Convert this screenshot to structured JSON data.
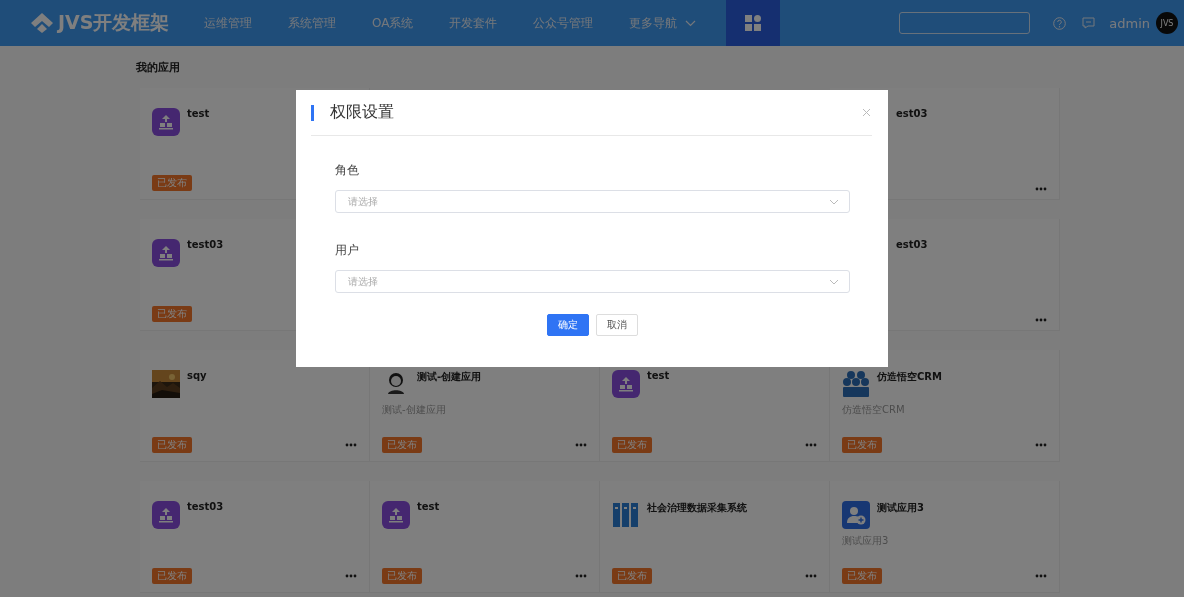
{
  "header": {
    "logo": "JVS开发框架",
    "nav": [
      {
        "label": "运维管理",
        "dropdown": false
      },
      {
        "label": "系统管理",
        "dropdown": false
      },
      {
        "label": "OA系统",
        "dropdown": false
      },
      {
        "label": "开发套件",
        "dropdown": false
      },
      {
        "label": "公众号管理",
        "dropdown": false
      },
      {
        "label": "更多导航",
        "dropdown": true
      }
    ],
    "user": "admin",
    "avatar": "JVS"
  },
  "section_title": "我的应用",
  "cards": [
    {
      "kind": "tile",
      "title": "test",
      "badge": "已发布",
      "menu": false
    },
    {
      "kind": "hidden"
    },
    {
      "kind": "hidden"
    },
    {
      "kind": "clipped",
      "title": "est03",
      "menu": true
    },
    {
      "kind": "tile",
      "title": "test03",
      "badge": "已发布",
      "menu": false
    },
    {
      "kind": "hidden"
    },
    {
      "kind": "hidden"
    },
    {
      "kind": "clipped",
      "title": "est03",
      "menu": true
    },
    {
      "title": "sqy",
      "badge": "已发布",
      "menu": true
    },
    {
      "kind": "figure",
      "title": "测试-创建应用",
      "description": "测试-创建应用",
      "badge": "已发布",
      "menu": true
    },
    {
      "kind": "tile",
      "title": "test",
      "badge": "已发布",
      "menu": true
    },
    {
      "kind": "crm",
      "title": "仿造悟空CRM",
      "description": "仿造悟空CRM",
      "badge": "已发布",
      "menu": true
    },
    {
      "kind": "tile",
      "title": "test03",
      "badge": "已发布",
      "menu": true
    },
    {
      "kind": "tile",
      "title": "test",
      "badge": "已发布",
      "menu": true
    },
    {
      "kind": "binders",
      "title": "社会治理数据采集系统",
      "badge": "已发布",
      "menu": true
    },
    {
      "kind": "user-tile",
      "title": "测试应用3",
      "description": "测试应用3",
      "badge": "已发布",
      "menu": true
    }
  ],
  "dialog": {
    "title": "权限设置",
    "fields": [
      {
        "label": "角色",
        "placeholder": "请选择"
      },
      {
        "label": "用户",
        "placeholder": "请选择"
      }
    ],
    "buttons": [
      {
        "label": "确定",
        "primary": true
      },
      {
        "label": "取消",
        "primary": false
      }
    ]
  }
}
